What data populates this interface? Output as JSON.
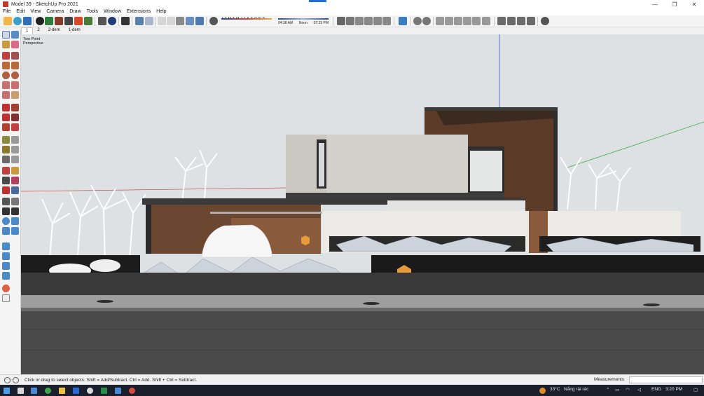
{
  "window": {
    "title": "Model 39 - SketchUp Pro 2021",
    "controls": [
      "—",
      "❐",
      "✕"
    ]
  },
  "menu": [
    "File",
    "Edit",
    "View",
    "Camera",
    "Draw",
    "Tools",
    "Window",
    "Extensions",
    "Help"
  ],
  "shadow_toolbar": {
    "months": [
      "J",
      "F",
      "M",
      "A",
      "M",
      "J",
      "J",
      "A",
      "S",
      "O",
      "N",
      "D"
    ],
    "time_start": "04:38 AM",
    "time_mid": "Noon",
    "time_end": "07:25 PM"
  },
  "scene_tabs": [
    "1",
    "2",
    "2-dem",
    "1-dem"
  ],
  "viewport": {
    "camera_label_line1": "Two Point",
    "camera_label_line2": "Perspective"
  },
  "status": {
    "hint": "Click or drag to select objects. Shift = Add/Subtract. Ctrl = Add. Shift + Ctrl = Subtract.",
    "measurements_label": "Measurements",
    "measurements_value": ""
  },
  "taskbar": {
    "weather": "33°C",
    "weather_desc": "Nắng rải rác",
    "language": "ENG",
    "time": "3:20 PM"
  },
  "colors": {
    "accent": "#1e6fd9",
    "sky": "#dde1e4",
    "wood": "#6b4631",
    "concrete": "#c9c7c2",
    "taskbar": "#1a1f2b"
  }
}
